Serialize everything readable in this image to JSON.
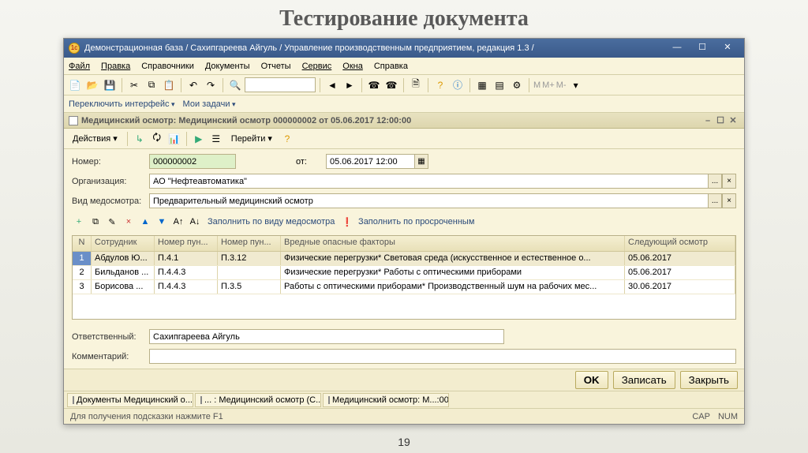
{
  "slide": {
    "title": "Тестирование документа",
    "page": "19"
  },
  "window": {
    "title": "Демонстрационная база / Сахипгареева Айгуль /  Управление производственным предприятием, редакция 1.3 /",
    "min": "—",
    "max": "☐",
    "close": "✕"
  },
  "menu": {
    "file": "Файл",
    "edit": "Правка",
    "refs": "Справочники",
    "docs": "Документы",
    "reports": "Отчеты",
    "service": "Сервис",
    "windows": "Окна",
    "help": "Справка"
  },
  "tabs": {
    "switch": "Переключить интерфейс",
    "tasks": "Мои задачи"
  },
  "doc": {
    "header": "Медицинский осмотр: Медицинский осмотр 000000002 от 05.06.2017 12:00:00",
    "actions": "Действия",
    "goto": "Перейти",
    "numLabel": "Номер:",
    "num": "000000002",
    "dateLabel": "от:",
    "date": "05.06.2017 12:00",
    "orgLabel": "Организация:",
    "org": "АО \"Нефтеавтоматика\"",
    "typeLabel": "Вид медосмотра:",
    "type": "Предварительный медицинский осмотр",
    "fillByType": "Заполнить по виду медосмотра",
    "fillOverdue": "Заполнить по просроченным",
    "respLabel": "Ответственный:",
    "resp": "Сахипгареева Айгуль",
    "commentLabel": "Комментарий:",
    "comment": ""
  },
  "cols": {
    "n": "N",
    "emp": "Сотрудник",
    "p1": "Номер пун...",
    "p2": "Номер пун...",
    "factors": "Вредные опасные факторы",
    "next": "Следующий осмотр"
  },
  "rows": [
    {
      "n": "1",
      "emp": "Абдулов Ю...",
      "p1": "П.4.1",
      "p2": "П.3.12",
      "factors": "Физические перегрузки* Световая среда (искусственное и естественное о...",
      "next": "05.06.2017"
    },
    {
      "n": "2",
      "emp": "Бильданов ...",
      "p1": "П.4.4.3",
      "p2": "",
      "factors": "Физические перегрузки* Работы с оптическими приборами",
      "next": "05.06.2017"
    },
    {
      "n": "3",
      "emp": "Борисова ...",
      "p1": "П.4.4.3",
      "p2": "П.3.5",
      "factors": "Работы с оптическими приборами* Производственный шум на рабочих мес...",
      "next": "30.06.2017"
    }
  ],
  "buttons": {
    "ok": "OK",
    "save": "Записать",
    "close": "Закрыть"
  },
  "wintabs": [
    "Документы Медицинский о...",
    "... : Медицинский осмотр (С...",
    "Медицинский осмотр: М...:00"
  ],
  "status": {
    "hint": "Для получения подсказки нажмите F1",
    "cap": "CAP",
    "num": "NUM"
  },
  "mm": {
    "m": "M",
    "mp": "M+",
    "mm": "M-"
  }
}
